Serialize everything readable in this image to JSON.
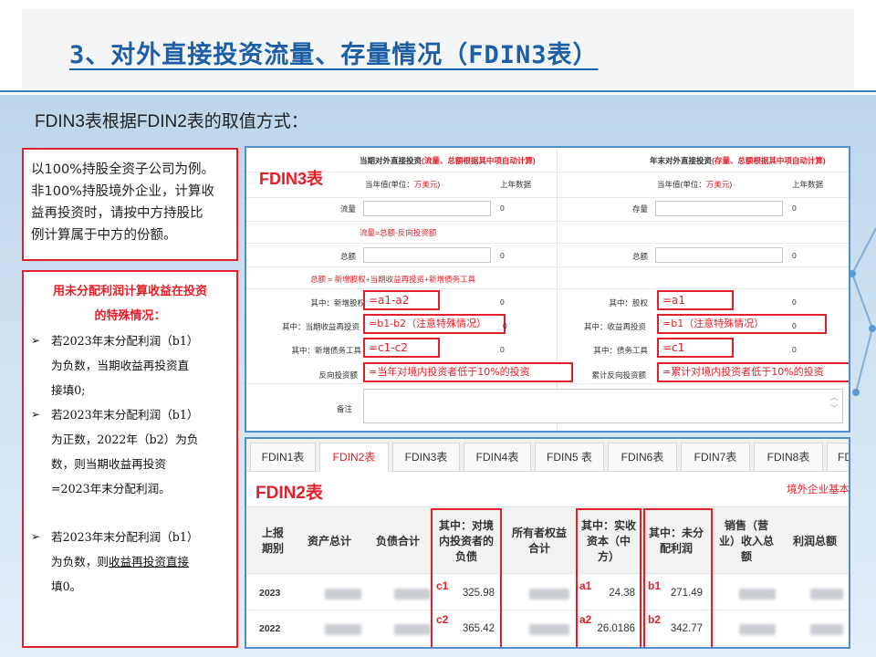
{
  "slide": {
    "title": "3、对外直接投资流量、存量情况（FDIN3表）",
    "subtitle": "FDIN3表根据FDIN2表的取值方式："
  },
  "note1": {
    "lines": [
      "以100%持股全资子公司为例。",
      "非100%持股境外企业，计算收",
      "益再投资时，请按中方持股比",
      "例计算属于中方的份额。"
    ]
  },
  "note2": {
    "head1": "用未分配利润计算收益在投资",
    "head2": "的特殊情况：",
    "bullet": "➢",
    "b1_lines": [
      "若2023年末分配利润（b1）",
      "为负数，当期收益再投资直",
      "接填0;"
    ],
    "b2_lines": [
      "若2023年末分配利润（b1）",
      "为正数，2022年（b2）为负",
      "数，则当期收益再投资",
      "=2023年末分配利润。"
    ],
    "b3_line1": "若2023年末分配利润（b1）",
    "b3_line2_pre": "为负数，则",
    "b3_line2_u": "收益再投资直接",
    "b3_line3": "填0。"
  },
  "fdin3": {
    "label": "FDIN3表",
    "left_header": {
      "pre": "当期对外直接投资",
      "red": "(流量、总额根据其中项自动计算)"
    },
    "right_header": {
      "pre": "年末对外直接投资",
      "red": "(存量、总额根据其中项自动计算)"
    },
    "col_cur_pre": "当年值(单位：",
    "col_cur_unit": "万美元",
    "col_cur_post": ")",
    "col_prev": "上年数据",
    "zero": "0",
    "left_rows": {
      "flow": "流量",
      "flow_note": "流量=总额-反向投资额",
      "total": "总额",
      "total_note": "总额 = 新增股权+当期收益再投资+新增债务工具",
      "equity": "其中：新增股权",
      "reinvest": "其中：当期收益再投资",
      "debt": "其中：新增债务工具",
      "reverse": "反向投资额"
    },
    "right_rows": {
      "stock": "存量",
      "total": "总额",
      "equity": "其中：股权",
      "reinvest": "其中：收益再投资",
      "debt": "其中：债务工具",
      "reverse": "累计反向投资额"
    },
    "remark": "备注",
    "formulas": {
      "l_equity": "=a1-a2",
      "l_reinvest": "=b1-b2（注意特殊情况）",
      "l_debt": "=c1-c2",
      "l_reverse": "=当年对境内投资者低于10%的投资",
      "r_equity": "=a1",
      "r_reinvest": "=b1（注意特殊情况）",
      "r_debt": "=c1",
      "r_reverse": "=累计对境内投资者低于10%的投资"
    },
    "scroll_up": "︿",
    "scroll_down": "﹀"
  },
  "fdin2": {
    "tabs": [
      "FDIN1表",
      "FDIN2表",
      "FDIN3表",
      "FDIN4表",
      "FDIN5 表",
      "FDIN6表",
      "FDIN7表",
      "FDIN8表",
      "FD"
    ],
    "active_tab": 1,
    "label": "FDIN2表",
    "right_text": "境外企业基本",
    "headers": {
      "period": [
        "上报",
        "期别"
      ],
      "assets": "资产总计",
      "liab": "负债合计",
      "debt_domestic": [
        "其中：对境",
        "内投资者的",
        "负债"
      ],
      "equity": [
        "所有者权益",
        "合计"
      ],
      "paidin": [
        "其中：实收",
        "资本（中",
        "方）"
      ],
      "retained": [
        "其中：未分",
        "配利润"
      ],
      "sales": [
        "销售（营",
        "业）收入总",
        "额"
      ],
      "profit": "利润总额"
    },
    "rows": [
      {
        "year": "2023",
        "c_tag": "c1",
        "c_val": "325.98",
        "a_tag": "a1",
        "a_val": "24.38",
        "b_tag": "b1",
        "b_val": "271.49"
      },
      {
        "year": "2022",
        "c_tag": "c2",
        "c_val": "365.42",
        "a_tag": "a2",
        "a_val": "26.0186",
        "b_tag": "b2",
        "b_val": "342.77"
      }
    ]
  },
  "colors": {
    "accent_red": "#e0202a",
    "title_blue": "#1d5fa6",
    "frame_blue": "#4f8fca"
  }
}
